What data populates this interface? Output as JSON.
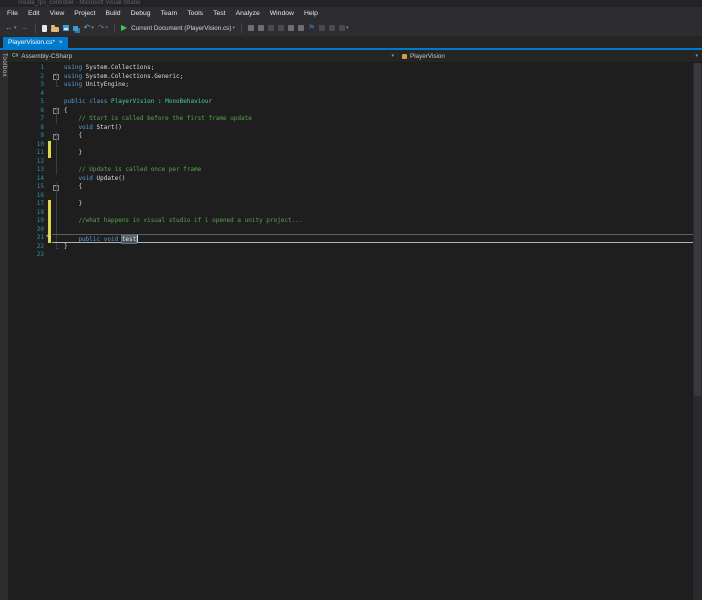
{
  "window": {
    "title": "create_fps_controller - Microsoft Visual Studio"
  },
  "menu": {
    "items": [
      "File",
      "Edit",
      "View",
      "Project",
      "Build",
      "Debug",
      "Team",
      "Tools",
      "Test",
      "Analyze",
      "Window",
      "Help"
    ]
  },
  "toolbar": {
    "items": [
      {
        "type": "glyph",
        "name": "navigate-backward-icon",
        "glyph": "←",
        "color": "#4da6e8"
      },
      {
        "type": "glyph",
        "name": "navigate-backward-caret-icon",
        "glyph": "▾",
        "color": "#8c8c8c",
        "small": true
      },
      {
        "type": "glyph",
        "name": "navigate-forward-icon",
        "glyph": "→",
        "color": "#666a70"
      },
      {
        "type": "sep"
      },
      {
        "type": "shape",
        "name": "new-file-icon",
        "shape": "new"
      },
      {
        "type": "shape",
        "name": "open-file-icon",
        "shape": "open"
      },
      {
        "type": "shape",
        "name": "save-icon",
        "shape": "save"
      },
      {
        "type": "shape",
        "name": "save-all-icon",
        "shape": "saveall"
      },
      {
        "type": "glyph",
        "name": "undo-icon",
        "glyph": "↶",
        "color": "#4da6e8"
      },
      {
        "type": "glyph",
        "name": "undo-caret-icon",
        "glyph": "▾",
        "color": "#8c8c8c",
        "small": true
      },
      {
        "type": "glyph",
        "name": "redo-icon",
        "glyph": "↷",
        "color": "#666a70"
      },
      {
        "type": "glyph",
        "name": "redo-caret-icon",
        "glyph": "▾",
        "color": "#666a70",
        "small": true
      },
      {
        "type": "sep"
      },
      {
        "type": "glyph",
        "name": "start-debug-icon",
        "glyph": "▶",
        "color": "#41c94c"
      },
      {
        "type": "label",
        "name": "debug-target-label",
        "label": "Current Document (PlayerVision.cs)"
      },
      {
        "type": "glyph",
        "name": "debug-target-caret-icon",
        "glyph": "▾",
        "color": "#8c8c8c",
        "small": true
      },
      {
        "type": "sep"
      },
      {
        "type": "shape",
        "name": "display-member-list-icon",
        "shape": "mini"
      },
      {
        "type": "shape",
        "name": "display-parameter-info-icon",
        "shape": "mini"
      },
      {
        "type": "shape",
        "name": "decrease-indent-icon",
        "shape": "mini dim"
      },
      {
        "type": "shape",
        "name": "increase-indent-icon",
        "shape": "mini dim"
      },
      {
        "type": "shape",
        "name": "comment-selection-icon",
        "shape": "mini"
      },
      {
        "type": "shape",
        "name": "uncomment-selection-icon",
        "shape": "mini"
      },
      {
        "type": "glyph",
        "name": "toggle-bookmark-icon",
        "glyph": "⚑",
        "color": "#3c5a8c"
      },
      {
        "type": "shape",
        "name": "previous-bookmark-icon",
        "shape": "mini dim"
      },
      {
        "type": "shape",
        "name": "next-bookmark-icon",
        "shape": "mini dim"
      },
      {
        "type": "shape",
        "name": "clear-bookmarks-icon",
        "shape": "mini dim"
      },
      {
        "type": "glyph",
        "name": "toolbar-options-caret-icon",
        "glyph": "▾",
        "color": "#8c8c8c",
        "small": true
      }
    ]
  },
  "tab": {
    "label": "PlayerVision.cs*"
  },
  "glyphs": {
    "caret": "▾",
    "close": "×",
    "collapse": "−",
    "pencil": "✎"
  },
  "navbar": {
    "project_icon": "C#",
    "project": "Assembly-CSharp",
    "type": "PlayerVision"
  },
  "toolbox": {
    "label": "Toolbox"
  },
  "colors": {
    "accent": "#007acc",
    "keyword": "#569cd6",
    "type_name": "#4ec9b0",
    "comment": "#57a64a",
    "text": "#dcdcdc",
    "line_number": "#2b91af",
    "change_bar": "#dcd94f",
    "editor_bg": "#1e1e1e"
  },
  "editor": {
    "lines": [
      {
        "n": 1,
        "o": "box",
        "seg": [
          [
            "kw",
            "using"
          ],
          [
            "pl",
            " System.Collections;"
          ]
        ]
      },
      {
        "n": 2,
        "o": "line",
        "seg": [
          [
            "kw",
            "using"
          ],
          [
            "pl",
            " System.Collections.Generic;"
          ]
        ]
      },
      {
        "n": 3,
        "o": "end",
        "seg": [
          [
            "kw",
            "using"
          ],
          [
            "pl",
            " UnityEngine;"
          ]
        ]
      },
      {
        "n": 4,
        "o": "",
        "seg": []
      },
      {
        "n": 5,
        "o": "box",
        "seg": [
          [
            "kw",
            "public class"
          ],
          [
            "pl",
            " "
          ],
          [
            "ty",
            "PlayerVision"
          ],
          [
            "pl",
            " : "
          ],
          [
            "ty",
            "MonoBehaviour"
          ]
        ]
      },
      {
        "n": 6,
        "o": "line",
        "seg": [
          [
            "pl",
            "{"
          ]
        ]
      },
      {
        "n": 7,
        "o": "line",
        "seg": [
          [
            "cm",
            "    // Start is called before the first frame update"
          ]
        ]
      },
      {
        "n": 8,
        "o": "box",
        "seg": [
          [
            "kw",
            "    void"
          ],
          [
            "pl",
            " Start()"
          ]
        ]
      },
      {
        "n": 9,
        "o": "line",
        "seg": [
          [
            "pl",
            "    {"
          ]
        ]
      },
      {
        "n": 10,
        "o": "line",
        "chg": true,
        "seg": []
      },
      {
        "n": 11,
        "o": "line",
        "chg": true,
        "seg": [
          [
            "pl",
            "    }"
          ]
        ]
      },
      {
        "n": 12,
        "o": "line",
        "seg": []
      },
      {
        "n": 13,
        "o": "line",
        "seg": [
          [
            "cm",
            "    // Update is called once per frame"
          ]
        ]
      },
      {
        "n": 14,
        "o": "box",
        "seg": [
          [
            "kw",
            "    void"
          ],
          [
            "pl",
            " Update()"
          ]
        ]
      },
      {
        "n": 15,
        "o": "line",
        "seg": [
          [
            "pl",
            "    {"
          ]
        ]
      },
      {
        "n": 16,
        "o": "line",
        "seg": []
      },
      {
        "n": 17,
        "o": "line",
        "chg": true,
        "seg": [
          [
            "pl",
            "    }"
          ]
        ]
      },
      {
        "n": 18,
        "o": "line",
        "chg": true,
        "seg": []
      },
      {
        "n": 19,
        "o": "line",
        "chg": true,
        "seg": [
          [
            "cm",
            "    //what happens in visual studio if i opened a unity project..."
          ]
        ]
      },
      {
        "n": 20,
        "o": "line",
        "chg": true,
        "seg": []
      },
      {
        "n": 21,
        "o": "line",
        "chg": true,
        "cur": true,
        "caret": true,
        "pencil": true,
        "seg": [
          [
            "kw",
            "    public void"
          ],
          [
            "pl",
            " "
          ],
          [
            "sel",
            "test"
          ]
        ]
      },
      {
        "n": 22,
        "o": "end",
        "seg": [
          [
            "pl",
            "}"
          ]
        ]
      },
      {
        "n": 23,
        "o": "",
        "seg": []
      }
    ]
  }
}
